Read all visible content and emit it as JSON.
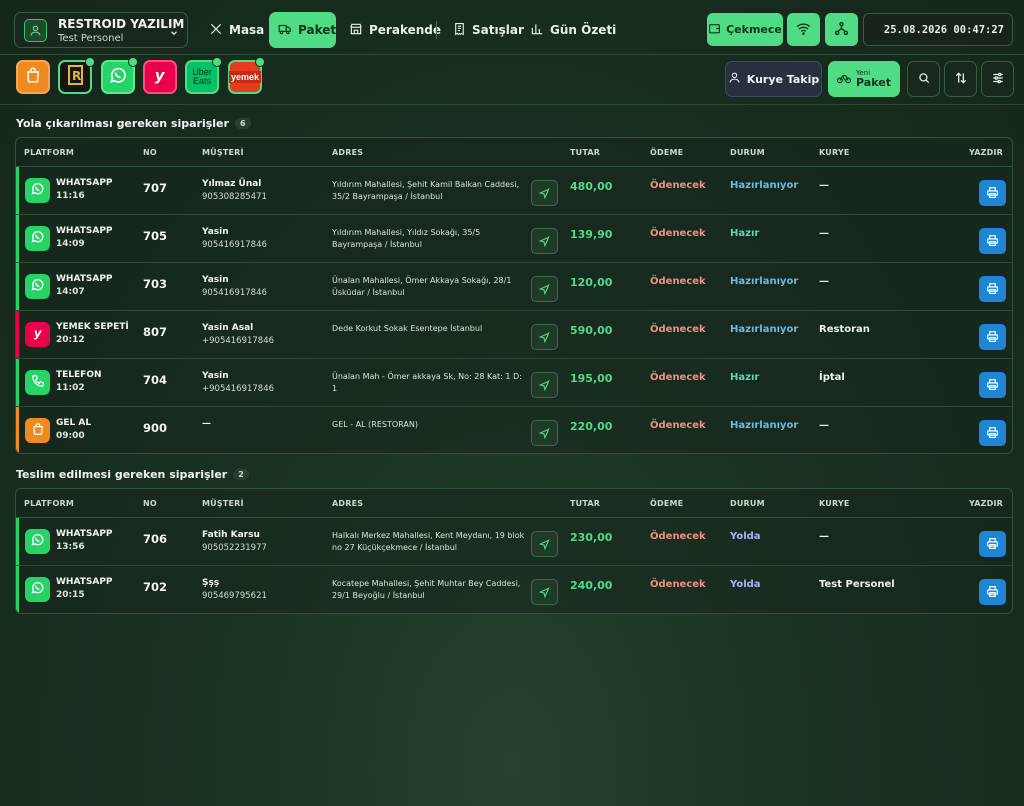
{
  "header": {
    "brand_name": "RESTROID YAZILIM",
    "user_role": "Test Personel",
    "nav": [
      {
        "label": "Masa"
      },
      {
        "label": "Paket"
      },
      {
        "label": "Perakende"
      },
      {
        "label": "Satışlar"
      },
      {
        "label": "Gün Özeti"
      }
    ],
    "drawer_label": "Çekmece",
    "datetime": "25.08.2026 00:47:27"
  },
  "toolbar": {
    "platforms": [
      {
        "icon": "shopping-bag-icon",
        "color": "#f08a1e"
      },
      {
        "icon": "restroid-app-icon",
        "color": "#1a1a1a"
      },
      {
        "icon": "whatsapp-icon",
        "color": "#25d366"
      },
      {
        "icon": "yemeksepeti-icon",
        "color": "#ea004b"
      },
      {
        "text": "Uber Eats",
        "icon": "uber-eats-icon",
        "color": "#06c167"
      },
      {
        "text": "yemek",
        "icon": "yemek-icon",
        "color": "#e63b1f"
      }
    ],
    "courier_tracking": "Kurye Takip",
    "new_small": "Yeni",
    "new_big": "Paket"
  },
  "colors": {
    "accent": "#4fdc85",
    "amount": "#52d98a",
    "payment_due": "#f08f86",
    "status_preparing": "#6fb8ea",
    "status_ready": "#5dd6b7",
    "status_on_way": "#a9b6f5",
    "print_button": "#1f86d6"
  },
  "columns": {
    "platform": "PLATFORM",
    "no": "NO",
    "customer": "MÜŞTERİ",
    "address": "ADRES",
    "amount": "TUTAR",
    "payment": "ÖDEME",
    "status": "DURUM",
    "courier": "KURYE",
    "print": "YAZDIR"
  },
  "section1": {
    "title": "Yola çıkarılması gereken siparişler",
    "count": "6",
    "rows": [
      {
        "platform": "WHATSAPP",
        "time": "11:16",
        "no": "707",
        "customer": "Yılmaz Ünal",
        "phone": "905308285471",
        "address": "Yıldırım Mahallesi, Şehit Kamil Balkan Caddesi, 35/2 Bayrampaşa / İstanbul",
        "amount": "480,00",
        "payment": "Ödenecek",
        "status": "Hazırlanıyor",
        "courier": "—",
        "icon": "whatsapp-icon",
        "color": "#25d366"
      },
      {
        "platform": "WHATSAPP",
        "time": "14:09",
        "no": "705",
        "customer": "Yasin",
        "phone": "905416917846",
        "address": "Yıldırım Mahallesi, Yıldız Sokağı, 35/5 Bayrampaşa / İstanbul",
        "amount": "139,90",
        "payment": "Ödenecek",
        "status": "Hazır",
        "courier": "—",
        "icon": "whatsapp-icon",
        "color": "#25d366"
      },
      {
        "platform": "WHATSAPP",
        "time": "14:07",
        "no": "703",
        "customer": "Yasin",
        "phone": "905416917846",
        "address": "Ünalan Mahallesi, Ömer Akkaya Sokağı, 28/1 Üsküdar / İstanbul",
        "amount": "120,00",
        "payment": "Ödenecek",
        "status": "Hazırlanıyor",
        "courier": "—",
        "icon": "whatsapp-icon",
        "color": "#25d366"
      },
      {
        "platform": "YEMEK SEPETİ",
        "time": "20:12",
        "no": "807",
        "customer": "Yasin Asal",
        "phone": "+905416917846",
        "address": "Dede Korkut Sokak Esentepe İstanbul",
        "amount": "590,00",
        "payment": "Ödenecek",
        "status": "Hazırlanıyor",
        "courier": "Restoran",
        "icon": "yemeksepeti-icon",
        "color": "#ea004b"
      },
      {
        "platform": "TELEFON",
        "time": "11:02",
        "no": "704",
        "customer": "Yasin",
        "phone": "+905416917846",
        "address": "Ünalan Mah - Ömer akkaya Sk, No: 28 Kat: 1 D: 1",
        "amount": "195,00",
        "payment": "Ödenecek",
        "status": "Hazır",
        "courier": "İptal",
        "icon": "phone-icon",
        "color": "#25d366"
      },
      {
        "platform": "GEL AL",
        "time": "09:00",
        "no": "900",
        "customer": "—",
        "phone": "",
        "address": "GEL - AL (RESTORAN)",
        "amount": "220,00",
        "payment": "Ödenecek",
        "status": "Hazırlanıyor",
        "courier": "—",
        "icon": "shopping-bag-icon",
        "color": "#f08a1e"
      }
    ]
  },
  "section2": {
    "title": "Teslim edilmesi gereken siparişler",
    "count": "2",
    "rows": [
      {
        "platform": "WHATSAPP",
        "time": "13:56",
        "no": "706",
        "customer": "Fatih Karsu",
        "phone": "905052231977",
        "address": "Halkalı Merkez Mahallesi, Kent Meydanı, 19 blok no 27 Küçükçekmece / İstanbul",
        "amount": "230,00",
        "payment": "Ödenecek",
        "status": "Yolda",
        "courier": "—",
        "icon": "whatsapp-icon",
        "color": "#25d366"
      },
      {
        "platform": "WHATSAPP",
        "time": "20:15",
        "no": "702",
        "customer": "Şşş",
        "phone": "905469795621",
        "address": "Kocatepe Mahallesi, Şehit Muhtar Bey Caddesi, 29/1 Beyoğlu / İstanbul",
        "amount": "240,00",
        "payment": "Ödenecek",
        "status": "Yolda",
        "courier": "Test Personel",
        "icon": "whatsapp-icon",
        "color": "#25d366"
      }
    ]
  }
}
